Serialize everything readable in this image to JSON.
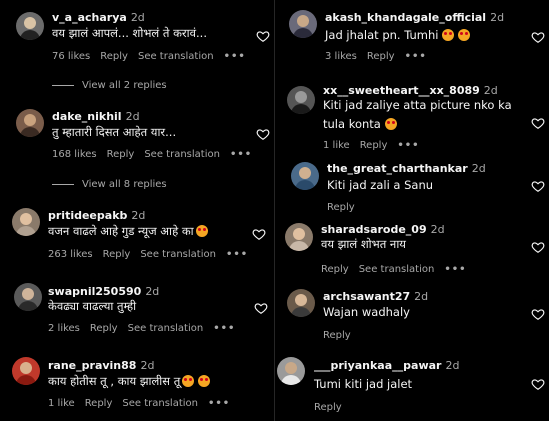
{
  "left": [
    {
      "username": "v_a_acharya",
      "age": "2d",
      "text": "वय झालं आपलं... शोभलं ते करावं...",
      "likes": "76 likes",
      "reply": "Reply",
      "see": "See translation",
      "viewall": "View all 2 replies",
      "avatarColor": "#6b6b6b",
      "emoji": 0
    },
    {
      "username": "dake_nikhil",
      "age": "2d",
      "text": "तु म्हातारी दिसत आहेत यार...",
      "likes": "168 likes",
      "reply": "Reply",
      "see": "See translation",
      "viewall": "View all 8 replies",
      "avatarColor": "#7a5c4a",
      "emoji": 0
    },
    {
      "username": "pritideepakb",
      "age": "2d",
      "text": "वजन वाढले आहे गुड न्यूज आहे का",
      "likes": "263 likes",
      "reply": "Reply",
      "see": "See translation",
      "viewall": "",
      "avatarColor": "#8a7a6a",
      "emoji": 1
    },
    {
      "username": "swapnil250590",
      "age": "2d",
      "text": "केवढ्या वाढल्या तुम्ही",
      "likes": "2 likes",
      "reply": "Reply",
      "see": "See translation",
      "viewall": "",
      "avatarColor": "#5a5a5a",
      "emoji": 0
    },
    {
      "username": "rane_pravin88",
      "age": "2d",
      "text": "काय होतीस तू , काय झालीस तू",
      "likes": "1 like",
      "reply": "Reply",
      "see": "See translation",
      "viewall": "",
      "avatarColor": "#c0392b",
      "emoji": 2
    }
  ],
  "right": [
    {
      "username": "akash_khandagale_official",
      "age": "2d",
      "text": "Jad jhalat pn. Tumhi",
      "likes": "3 likes",
      "reply": "Reply",
      "see": "",
      "avatarColor": "#6a6a7a",
      "emoji": 2
    },
    {
      "username": "xx__sweetheart__xx_8089",
      "age": "2d",
      "text": "Kiti jad zaliye atta picture nko ka",
      "text2": "tula konta",
      "likes": "1 like",
      "reply": "Reply",
      "see": "",
      "avatarColor": "#555555",
      "emoji": 1
    },
    {
      "username": "the_great_charthankar",
      "age": "2d",
      "text": "Kiti jad zali a Sanu",
      "likes": "",
      "reply": "Reply",
      "see": "",
      "avatarColor": "#4a6a8a",
      "emoji": 0
    },
    {
      "username": "sharadsarode_09",
      "age": "2d",
      "text": "वय झालं शोभत नाय",
      "likes": "",
      "reply": "Reply",
      "see": "See translation",
      "avatarColor": "#8a7a6a",
      "emoji": 0
    },
    {
      "username": "archsawant27",
      "age": "2d",
      "text": "Wajan wadhaly",
      "likes": "",
      "reply": "Reply",
      "see": "",
      "avatarColor": "#6a5a4a",
      "emoji": 0
    },
    {
      "username": "___priyankaa__pawar",
      "age": "2d",
      "text": "Tumi kiti jad jalet",
      "likes": "",
      "reply": "Reply",
      "see": "",
      "avatarColor": "#9a9a9a",
      "emoji": 0
    }
  ]
}
